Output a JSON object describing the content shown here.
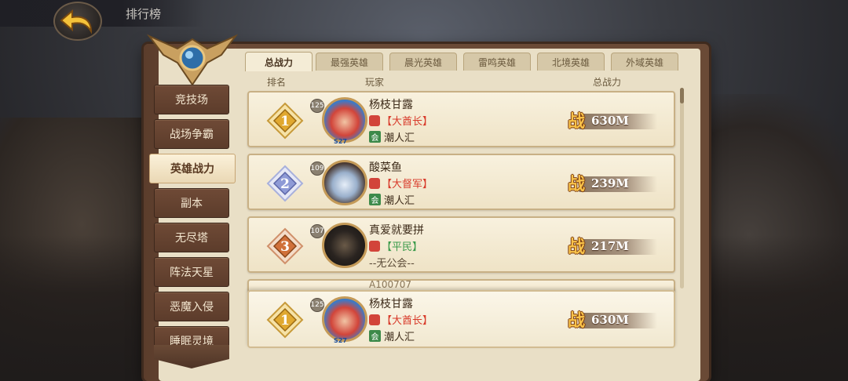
{
  "header": {
    "title": "排行榜"
  },
  "sidebar": {
    "items": [
      {
        "label": "竞技场",
        "active": false
      },
      {
        "label": "战场争霸",
        "active": false
      },
      {
        "label": "英雄战力",
        "active": true
      },
      {
        "label": "副本",
        "active": false
      },
      {
        "label": "无尽塔",
        "active": false
      },
      {
        "label": "阵法天星",
        "active": false
      },
      {
        "label": "恶魔入侵",
        "active": false
      },
      {
        "label": "睡眠灵境",
        "active": false
      }
    ]
  },
  "tabs": [
    {
      "label": "总战力",
      "active": true
    },
    {
      "label": "最强英雄",
      "active": false
    },
    {
      "label": "晨光英雄",
      "active": false
    },
    {
      "label": "雷鸣英雄",
      "active": false
    },
    {
      "label": "北境英雄",
      "active": false
    },
    {
      "label": "外域英雄",
      "active": false
    }
  ],
  "columns": {
    "rank": "排名",
    "player": "玩家",
    "power": "总战力"
  },
  "rows": [
    {
      "rank": "1",
      "level": "125",
      "name": "杨枝甘露",
      "title": "【大酋长】",
      "title_color": "#d83a2a",
      "guild": "潮人汇",
      "power": "630M",
      "season": "S27"
    },
    {
      "rank": "2",
      "level": "109",
      "name": "酸菜鱼",
      "title": "【大督军】",
      "title_color": "#d83a2a",
      "guild": "潮人汇",
      "power": "239M"
    },
    {
      "rank": "3",
      "level": "107",
      "name": "真爱就要拼",
      "title": "【平民】",
      "title_color": "#3a9a4a",
      "guild": "--无公会--",
      "power": "217M"
    },
    {
      "name": "A100707"
    }
  ],
  "self_row": {
    "rank": "1",
    "level": "125",
    "name": "杨枝甘露",
    "title": "【大酋长】",
    "title_color": "#d83a2a",
    "guild": "潮人汇",
    "power": "630M",
    "season": "S27"
  },
  "power_glyph": "战",
  "guild_glyph": "会",
  "colors": {
    "gold": "#e0a830",
    "silver": "#8e9ad6",
    "bronze": "#d0703a"
  }
}
